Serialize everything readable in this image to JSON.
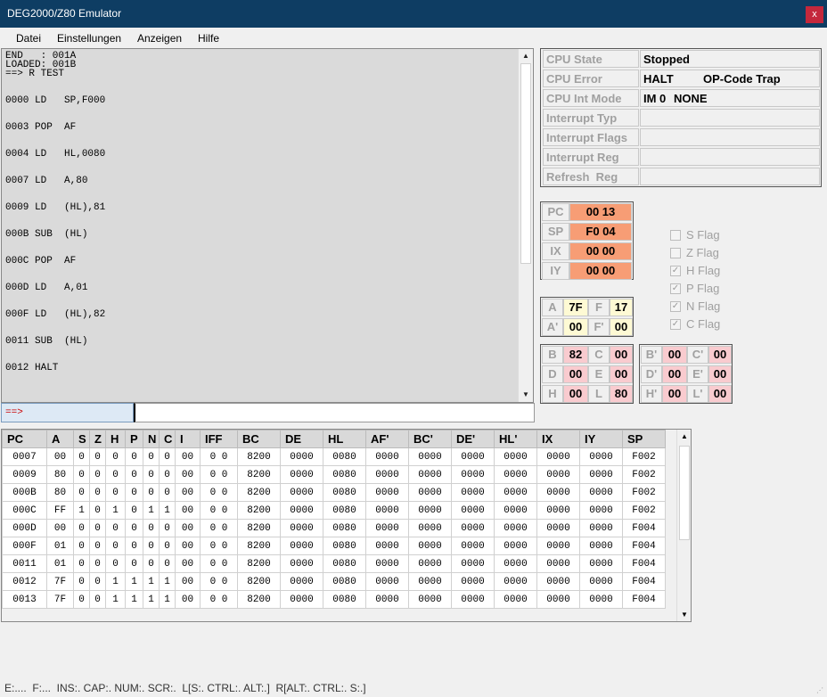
{
  "window": {
    "title": "DEG2000/Z80 Emulator",
    "close_label": "x"
  },
  "menu": [
    "Datei",
    "Einstellungen",
    "Anzeigen",
    "Hilfe"
  ],
  "console": {
    "header": [
      "END   : 001A",
      "LOADED: 001B",
      "==> R TEST"
    ],
    "lines": [
      "0000 LD   SP,F000",
      "0003 POP  AF",
      "0004 LD   HL,0080",
      "0007 LD   A,80",
      "0009 LD   (HL),81",
      "000B SUB  (HL)",
      "000C POP  AF",
      "000D LD   A,01",
      "000F LD   (HL),82",
      "0011 SUB  (HL)",
      "0012 HALT"
    ],
    "prompt": "==>",
    "input_value": ""
  },
  "cpu_state": {
    "rows": [
      {
        "label": "CPU State",
        "value": "Stopped",
        "value2": ""
      },
      {
        "label": "CPU Error",
        "value": "HALT",
        "value2": "OP-Code Trap"
      },
      {
        "label": "CPU Int Mode",
        "value": "IM 0",
        "value2": "NONE"
      },
      {
        "label": "Interrupt Typ",
        "value": "",
        "value2": ""
      },
      {
        "label": "Interrupt Flags",
        "value": "",
        "value2": ""
      },
      {
        "label": "Interrupt Reg",
        "value": "",
        "value2": ""
      },
      {
        "label": "Refresh  Reg",
        "value": "",
        "value2": ""
      }
    ]
  },
  "regs16": [
    {
      "label": "PC",
      "value": "00 13"
    },
    {
      "label": "SP",
      "value": "F0 04"
    },
    {
      "label": "IX",
      "value": "00 00"
    },
    {
      "label": "IY",
      "value": "00 00"
    }
  ],
  "regs_af": {
    "A": "7F",
    "F": "17",
    "A_": "00",
    "F_": "00",
    "labels": {
      "A": "A",
      "F": "F",
      "A_": "A'",
      "F_": "F'"
    }
  },
  "regs_main": {
    "B": "82",
    "C": "00",
    "D": "00",
    "E": "00",
    "H": "00",
    "L": "80",
    "labels": {
      "B": "B",
      "C": "C",
      "D": "D",
      "E": "E",
      "H": "H",
      "L": "L"
    }
  },
  "regs_alt": {
    "B": "00",
    "C": "00",
    "D": "00",
    "E": "00",
    "H": "00",
    "L": "00",
    "labels": {
      "B": "B'",
      "C": "C'",
      "D": "D'",
      "E": "E'",
      "H": "H'",
      "L": "L'"
    }
  },
  "flags": [
    {
      "label": "S Flag",
      "checked": false
    },
    {
      "label": "Z Flag",
      "checked": false
    },
    {
      "label": "H Flag",
      "checked": true
    },
    {
      "label": "P Flag",
      "checked": true
    },
    {
      "label": "N Flag",
      "checked": true
    },
    {
      "label": "C Flag",
      "checked": true
    }
  ],
  "trace": {
    "columns": [
      "PC",
      "A",
      "S",
      "Z",
      "H",
      "P",
      "N",
      "C",
      "I",
      "IFF",
      "BC",
      "DE",
      "HL",
      "AF'",
      "BC'",
      "DE'",
      "HL'",
      "IX",
      "IY",
      "SP"
    ],
    "rows": [
      [
        "0007",
        "00",
        "0",
        "0",
        "0",
        "0",
        "0",
        "0",
        "00",
        "0 0",
        "8200",
        "0000",
        "0080",
        "0000",
        "0000",
        "0000",
        "0000",
        "0000",
        "0000",
        "F002"
      ],
      [
        "0009",
        "80",
        "0",
        "0",
        "0",
        "0",
        "0",
        "0",
        "00",
        "0 0",
        "8200",
        "0000",
        "0080",
        "0000",
        "0000",
        "0000",
        "0000",
        "0000",
        "0000",
        "F002"
      ],
      [
        "000B",
        "80",
        "0",
        "0",
        "0",
        "0",
        "0",
        "0",
        "00",
        "0 0",
        "8200",
        "0000",
        "0080",
        "0000",
        "0000",
        "0000",
        "0000",
        "0000",
        "0000",
        "F002"
      ],
      [
        "000C",
        "FF",
        "1",
        "0",
        "1",
        "0",
        "1",
        "1",
        "00",
        "0 0",
        "8200",
        "0000",
        "0080",
        "0000",
        "0000",
        "0000",
        "0000",
        "0000",
        "0000",
        "F002"
      ],
      [
        "000D",
        "00",
        "0",
        "0",
        "0",
        "0",
        "0",
        "0",
        "00",
        "0 0",
        "8200",
        "0000",
        "0080",
        "0000",
        "0000",
        "0000",
        "0000",
        "0000",
        "0000",
        "F004"
      ],
      [
        "000F",
        "01",
        "0",
        "0",
        "0",
        "0",
        "0",
        "0",
        "00",
        "0 0",
        "8200",
        "0000",
        "0080",
        "0000",
        "0000",
        "0000",
        "0000",
        "0000",
        "0000",
        "F004"
      ],
      [
        "0011",
        "01",
        "0",
        "0",
        "0",
        "0",
        "0",
        "0",
        "00",
        "0 0",
        "8200",
        "0000",
        "0080",
        "0000",
        "0000",
        "0000",
        "0000",
        "0000",
        "0000",
        "F004"
      ],
      [
        "0012",
        "7F",
        "0",
        "0",
        "1",
        "1",
        "1",
        "1",
        "00",
        "0 0",
        "8200",
        "0000",
        "0080",
        "0000",
        "0000",
        "0000",
        "0000",
        "0000",
        "0000",
        "F004"
      ],
      [
        "0013",
        "7F",
        "0",
        "0",
        "1",
        "1",
        "1",
        "1",
        "00",
        "0 0",
        "8200",
        "0000",
        "0080",
        "0000",
        "0000",
        "0000",
        "0000",
        "0000",
        "0000",
        "F004"
      ]
    ]
  },
  "status": "E:....  F:...  INS:. CAP:. NUM:. SCR:.  L[S:. CTRL:. ALT:.]  R[ALT:. CTRL:. S:.]",
  "colors": {
    "title_bar": "#0e3d63",
    "close": "#c4283c",
    "reg16": "#f79d75",
    "reg_af": "#fefad4",
    "reg_gp": "#f9cbcf"
  }
}
